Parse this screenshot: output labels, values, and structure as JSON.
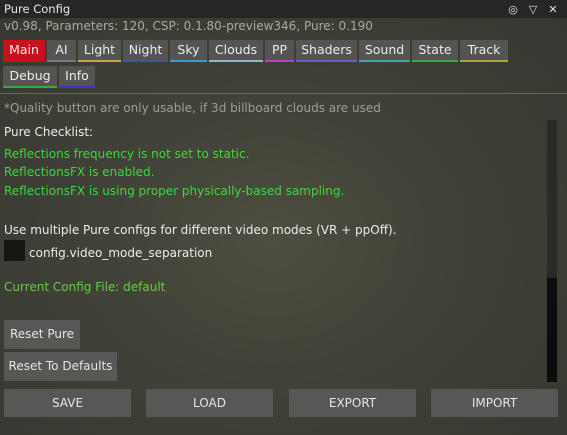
{
  "window": {
    "title": "Pure Config"
  },
  "titlebar_icons": [
    {
      "name": "settings-icon",
      "glyph": "◎"
    },
    {
      "name": "collapse-icon",
      "glyph": "▽"
    },
    {
      "name": "close-icon",
      "glyph": "✕"
    }
  ],
  "version_line": "v0.98, Parameters: 120, CSP: 0.1.80-preview346, Pure: 0.190",
  "tabs": [
    {
      "label": "Main",
      "accent": "#c8101c",
      "active": true
    },
    {
      "label": "AI",
      "accent": "#7a7a7a"
    },
    {
      "label": "Light",
      "accent": "#c8a838"
    },
    {
      "label": "Night",
      "accent": "#3a5aa8"
    },
    {
      "label": "Sky",
      "accent": "#3a9ad8"
    },
    {
      "label": "Clouds",
      "accent": "#9ab4c8"
    },
    {
      "label": "PP",
      "accent": "#c838c8"
    },
    {
      "label": "Shaders",
      "accent": "#6a5ac8"
    },
    {
      "label": "Sound",
      "accent": "#38a8a8"
    },
    {
      "label": "State",
      "accent": "#3aa83a"
    },
    {
      "label": "Track",
      "accent": "#a8a838"
    },
    {
      "label": "Debug",
      "accent": "#38a838"
    },
    {
      "label": "Info",
      "accent": "#3838c8"
    }
  ],
  "note": "*Quality button are only usable, if 3d billboard clouds are used",
  "checklist": {
    "heading": "Pure Checklist:",
    "items": [
      "Reflections frequency is not set to static.",
      "ReflectionsFX is enabled.",
      "ReflectionsFX is using proper physically-based sampling."
    ]
  },
  "multi_config": {
    "description": "Use multiple Pure configs for different video modes (VR + ppOff).",
    "checkbox_label": "config.video_mode_separation",
    "checked": false
  },
  "current_config": "Current Config File: default",
  "buttons": {
    "reset_pure": "Reset Pure",
    "reset_defaults": "Reset To Defaults"
  },
  "bottom": {
    "save": "SAVE",
    "load": "LOAD",
    "export": "EXPORT",
    "import": "IMPORT"
  }
}
